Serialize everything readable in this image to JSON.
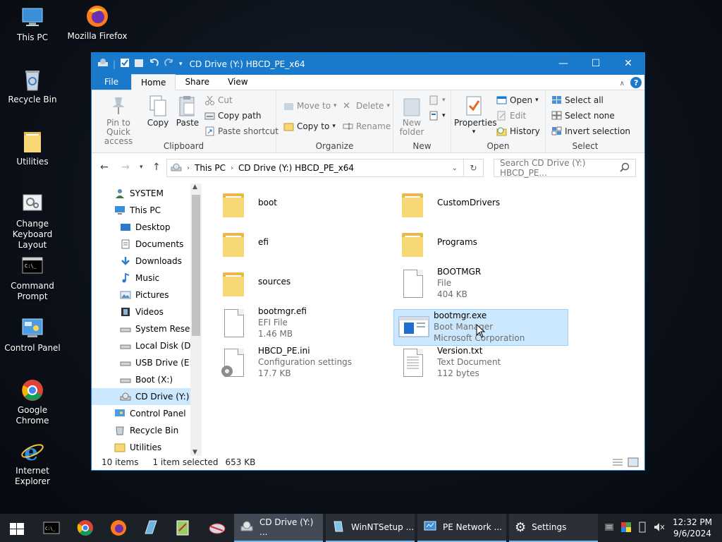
{
  "desktop": {
    "icons": [
      {
        "label": "This PC"
      },
      {
        "label": "Mozilla Firefox"
      },
      {
        "label": "Recycle Bin"
      },
      {
        "label": "Utilities"
      },
      {
        "label": "Change Keyboard Layout"
      },
      {
        "label": "Command Prompt"
      },
      {
        "label": "Control Panel"
      },
      {
        "label": "Google Chrome"
      },
      {
        "label": "Internet Explorer"
      }
    ]
  },
  "window": {
    "title": "CD Drive (Y:) HBCD_PE_x64",
    "tabs": [
      "File",
      "Home",
      "Share",
      "View"
    ],
    "ribbon": {
      "clipboard": {
        "label": "Clipboard",
        "pin": "Pin to Quick access",
        "copy": "Copy",
        "paste": "Paste",
        "cut": "Cut",
        "copy_path": "Copy path",
        "paste_shortcut": "Paste shortcut"
      },
      "organize": {
        "label": "Organize",
        "move_to": "Move to",
        "copy_to": "Copy to",
        "delete": "Delete",
        "rename": "Rename"
      },
      "new": {
        "label": "New",
        "new_folder": "New folder"
      },
      "open": {
        "label": "Open",
        "properties": "Properties",
        "open": "Open",
        "edit": "Edit",
        "history": "History"
      },
      "select": {
        "label": "Select",
        "select_all": "Select all",
        "select_none": "Select none",
        "invert": "Invert selection"
      }
    },
    "address": {
      "crumb1": "This PC",
      "crumb2": "CD Drive (Y:) HBCD_PE_x64",
      "search_placeholder": "Search CD Drive (Y:) HBCD_PE..."
    },
    "nav": [
      {
        "label": "SYSTEM"
      },
      {
        "label": "This PC"
      },
      {
        "label": "Desktop"
      },
      {
        "label": "Documents"
      },
      {
        "label": "Downloads"
      },
      {
        "label": "Music"
      },
      {
        "label": "Pictures"
      },
      {
        "label": "Videos"
      },
      {
        "label": "System Reserve"
      },
      {
        "label": "Local Disk (D:)"
      },
      {
        "label": "USB Drive (E:)"
      },
      {
        "label": "Boot (X:)"
      },
      {
        "label": "CD Drive (Y:) H"
      },
      {
        "label": "Control Panel"
      },
      {
        "label": "Recycle Bin"
      },
      {
        "label": "Utilities"
      }
    ],
    "files": [
      {
        "name": "boot",
        "line2": "",
        "line3": ""
      },
      {
        "name": "CustomDrivers",
        "line2": "",
        "line3": ""
      },
      {
        "name": "efi",
        "line2": "",
        "line3": ""
      },
      {
        "name": "Programs",
        "line2": "",
        "line3": ""
      },
      {
        "name": "sources",
        "line2": "",
        "line3": ""
      },
      {
        "name": "BOOTMGR",
        "line2": "File",
        "line3": "404 KB"
      },
      {
        "name": "bootmgr.efi",
        "line2": "EFI File",
        "line3": "1.46 MB"
      },
      {
        "name": "bootmgr.exe",
        "line2": "Boot Manager",
        "line3": "Microsoft Corporation"
      },
      {
        "name": "HBCD_PE.ini",
        "line2": "Configuration settings",
        "line3": "17.7 KB"
      },
      {
        "name": "Version.txt",
        "line2": "Text Document",
        "line3": "112 bytes"
      }
    ],
    "status": {
      "count": "10 items",
      "selected": "1 item selected",
      "size": "653 KB"
    }
  },
  "taskbar": {
    "tasks": [
      {
        "label": "CD Drive (Y:) ..."
      },
      {
        "label": "WinNTSetup ..."
      },
      {
        "label": "PE Network ..."
      },
      {
        "label": "Settings"
      }
    ],
    "time": "12:32 PM",
    "date": "9/6/2024"
  },
  "colors": {
    "accent": "#1979ca",
    "selection": "#cce8ff",
    "folder": "#f8d775"
  }
}
